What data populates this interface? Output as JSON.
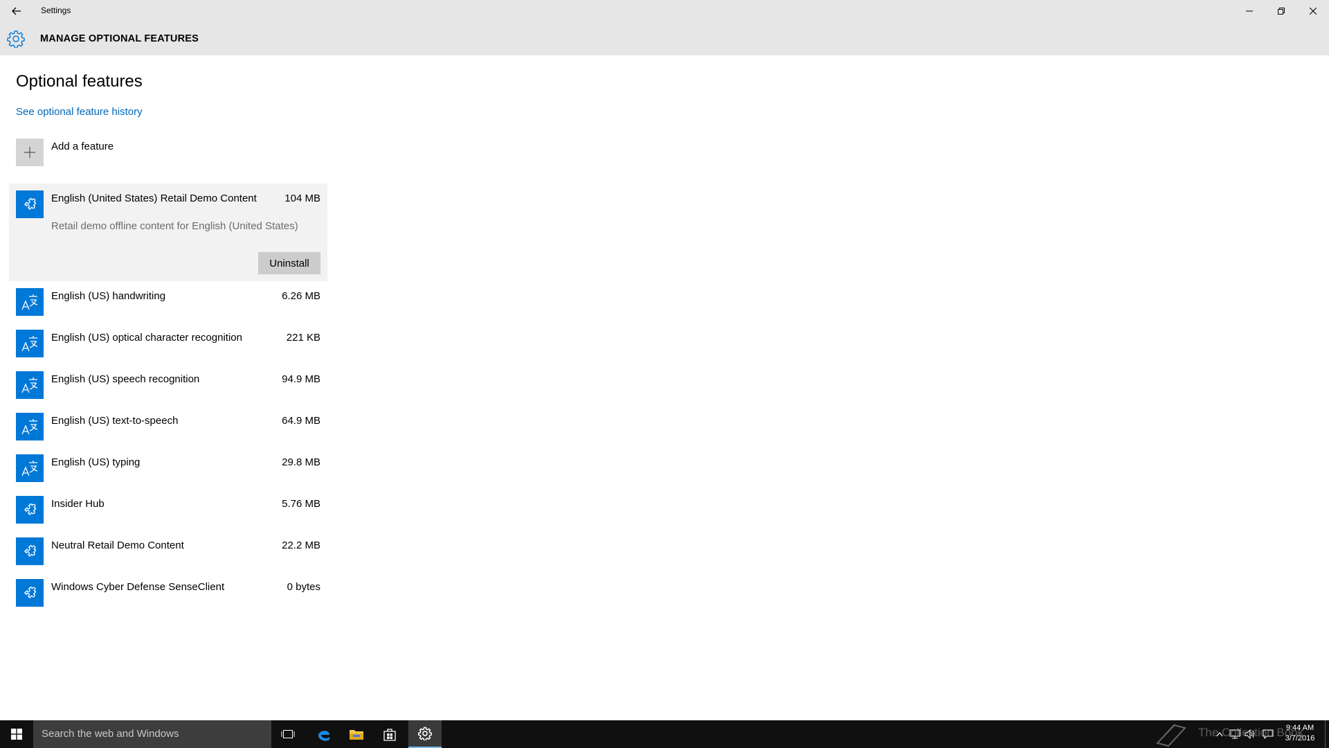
{
  "window": {
    "app_title": "Settings",
    "header_title": "MANAGE OPTIONAL FEATURES"
  },
  "page": {
    "title": "Optional features",
    "history_link": "See optional feature history",
    "add_feature_label": "Add a feature"
  },
  "features": [
    {
      "name": "English (United States) Retail Demo Content",
      "size": "104 MB",
      "icon": "puzzle-icon",
      "expanded": true,
      "description": "Retail demo offline content for English (United States)",
      "action": "Uninstall"
    },
    {
      "name": "English (US) handwriting",
      "size": "6.26 MB",
      "icon": "language-icon"
    },
    {
      "name": "English (US) optical character recognition",
      "size": "221 KB",
      "icon": "language-icon"
    },
    {
      "name": "English (US) speech recognition",
      "size": "94.9 MB",
      "icon": "language-icon"
    },
    {
      "name": "English (US) text-to-speech",
      "size": "64.9 MB",
      "icon": "language-icon"
    },
    {
      "name": "English (US) typing",
      "size": "29.8 MB",
      "icon": "language-icon"
    },
    {
      "name": "Insider Hub",
      "size": "5.76 MB",
      "icon": "puzzle-icon"
    },
    {
      "name": "Neutral Retail Demo Content",
      "size": "22.2 MB",
      "icon": "puzzle-icon"
    },
    {
      "name": "Windows Cyber Defense SenseClient",
      "size": "0 bytes",
      "icon": "puzzle-icon"
    }
  ],
  "taskbar": {
    "search_placeholder": "Search the web and Windows",
    "clock_time": "9:44 AM",
    "clock_date": "3/7/2016",
    "watermark": "The Collection Book"
  },
  "colors": {
    "accent": "#0078d7",
    "link": "#0067b8",
    "titlebar": "#e6e6e6",
    "taskbar": "#101010"
  }
}
